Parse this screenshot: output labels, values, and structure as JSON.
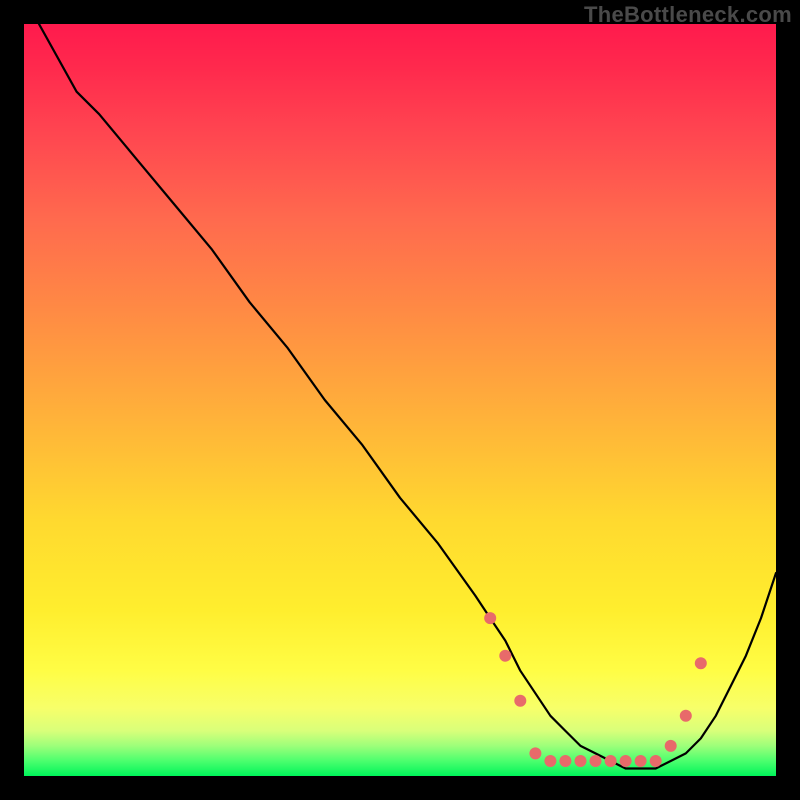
{
  "watermark": "TheBottleneck.com",
  "chart_data": {
    "type": "line",
    "title": "",
    "xlabel": "",
    "ylabel": "",
    "xlim": [
      0,
      100
    ],
    "ylim": [
      0,
      100
    ],
    "series": [
      {
        "name": "bottleneck-curve",
        "x": [
          2,
          7,
          10,
          15,
          20,
          25,
          30,
          35,
          40,
          45,
          50,
          55,
          60,
          62,
          64,
          66,
          68,
          70,
          72,
          74,
          76,
          78,
          80,
          82,
          84,
          86,
          88,
          90,
          92,
          94,
          96,
          98,
          100
        ],
        "y": [
          100,
          91,
          88,
          82,
          76,
          70,
          63,
          57,
          50,
          44,
          37,
          31,
          24,
          21,
          18,
          14,
          11,
          8,
          6,
          4,
          3,
          2,
          1,
          1,
          1,
          2,
          3,
          5,
          8,
          12,
          16,
          21,
          27
        ]
      }
    ],
    "markers": {
      "name": "highlight-dots",
      "color": "#e86a6a",
      "points": [
        {
          "x": 62,
          "y": 21
        },
        {
          "x": 64,
          "y": 16
        },
        {
          "x": 66,
          "y": 10
        },
        {
          "x": 68,
          "y": 3
        },
        {
          "x": 70,
          "y": 2
        },
        {
          "x": 72,
          "y": 2
        },
        {
          "x": 74,
          "y": 2
        },
        {
          "x": 76,
          "y": 2
        },
        {
          "x": 78,
          "y": 2
        },
        {
          "x": 80,
          "y": 2
        },
        {
          "x": 82,
          "y": 2
        },
        {
          "x": 84,
          "y": 2
        },
        {
          "x": 86,
          "y": 4
        },
        {
          "x": 88,
          "y": 8
        },
        {
          "x": 90,
          "y": 15
        }
      ]
    }
  }
}
